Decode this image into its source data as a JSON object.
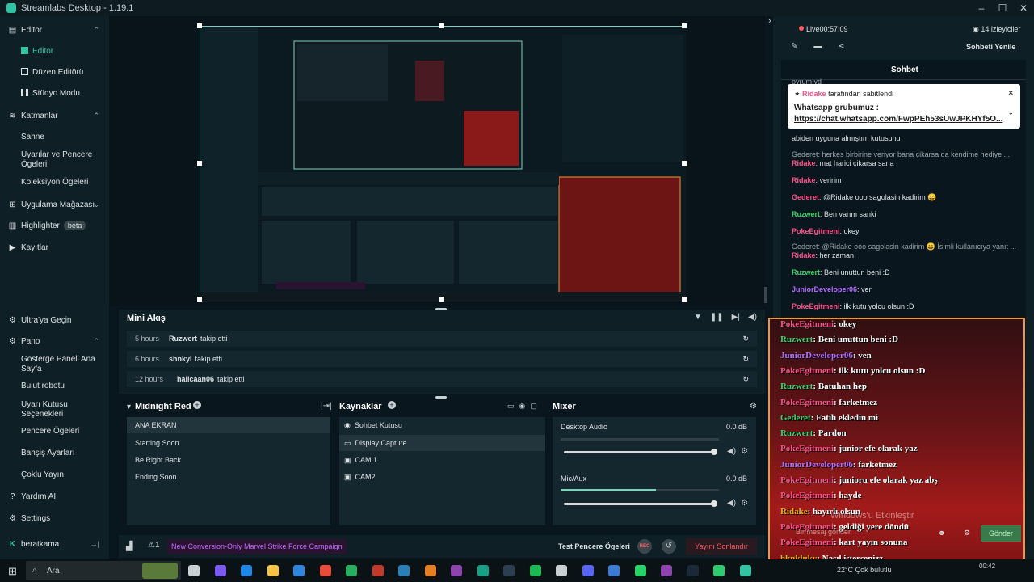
{
  "window": {
    "title": "Streamlabs Desktop - 1.19.1"
  },
  "sidebar": {
    "editor": "Editör",
    "editor_sub": [
      "Editör",
      "Düzen Editörü",
      "Stüdyo Modu"
    ],
    "layers": "Katmanlar",
    "layers_sub": [
      "Sahne",
      "Uyarılar ve Pencere Ögeleri",
      "Koleksiyon Ögeleri"
    ],
    "app_store": "Uygulama Mağazası",
    "highlighter": "Highlighter",
    "highlighter_badge": "beta",
    "recordings": "Kayıtlar",
    "ultra": "Ultra'ya Geçin",
    "dashboard": "Pano",
    "dashboard_sub": [
      "Gösterge Paneli Ana Sayfa",
      "Bulut robotu",
      "Uyarı Kutusu Seçenekleri",
      "Pencere Ögeleri",
      "Bahşiş Ayarları",
      "Çoklu Yayın"
    ],
    "help": "Yardım AI",
    "settings": "Settings",
    "user": "beratkama"
  },
  "mini_feed": {
    "title": "Mini Akış",
    "rows": [
      {
        "time": "5 hours",
        "user": "Ruzwert",
        "action": "takip etti"
      },
      {
        "time": "6 hours",
        "user": "shnkyl",
        "action": "takip etti"
      },
      {
        "time": "12 hours",
        "user": "hallcaan06",
        "action": "takip etti"
      }
    ]
  },
  "scenes": {
    "title": "Midnight Red",
    "items": [
      "ANA EKRAN",
      "Starting Soon",
      "Be Right Back",
      "Ending Soon"
    ],
    "selected": "ANA EKRAN"
  },
  "sources": {
    "title": "Kaynaklar",
    "items": [
      "Sohbet Kutusu",
      "Display Capture",
      "CAM 1",
      "CAM2"
    ],
    "selected": "Display Capture"
  },
  "mixer": {
    "title": "Mixer",
    "channels": [
      {
        "name": "Desktop Audio",
        "db": "0.0 dB",
        "level": 0.0,
        "volume": 0.98
      },
      {
        "name": "Mic/Aux",
        "db": "0.0 dB",
        "level": 0.6,
        "volume": 0.98
      }
    ]
  },
  "footer": {
    "alert_count": "1",
    "campaign": "New Conversion-Only Marvel Strike Force Campaign",
    "test_label": "Test Pencere Ögeleri",
    "rec": "REC",
    "end_stream": "Yayını Sonlandır"
  },
  "live": {
    "status": "Live",
    "time": "00:57:09",
    "viewers": "14 izleyiciler",
    "refresh": "Sohbeti Yenile"
  },
  "chat": {
    "title": "Sohbet",
    "top_partial": "oyrum yd",
    "pinned_by": "Ridake",
    "pinned_suffix": "tarafından sabitlendi",
    "pinned_text": "Whatsapp grubumuz :",
    "pinned_link": "https://chat.whatsapp.com/FwpPEh53sUwJPKHYf5O...",
    "partial_line": "abiden uyguna almıştım kutusunu",
    "reply1": "Gederet: herkes birbirine veriyor bana çikarsa da kendime hediye ...",
    "messages": [
      {
        "user": "Ridake",
        "text": "mat harici çikarsa sana",
        "color": "#ff4f8b"
      },
      {
        "user": "Ridake",
        "text": "veririm",
        "color": "#ff4f8b"
      },
      {
        "user": "Gederet",
        "text": "@Ridake ooo sagolasin kadirim 😄",
        "color": "#ff4f8b"
      },
      {
        "user": "Ruzwert",
        "text": "Ben varım sanki",
        "color": "#38d46b"
      },
      {
        "user": "PokeEgitmeni",
        "text": "okey",
        "color": "#ff4f8b"
      }
    ],
    "reply2": "Gederet: @Ridake ooo sagolasin kadirim 😄 İsimli kullanıcıya yanıt ...",
    "messages2": [
      {
        "user": "Ridake",
        "text": "her zaman",
        "color": "#ff4f8b"
      },
      {
        "user": "Ruzwert",
        "text": "Beni unuttun beni :D",
        "color": "#38d46b"
      },
      {
        "user": "JuniorDeveloper06",
        "text": "ven",
        "color": "#b36bff"
      },
      {
        "user": "PokeEgitmeni",
        "text": "ilk kutu yolcu olsun :D",
        "color": "#ff4f8b"
      }
    ],
    "input_placeholder": "Bir mesaj gönder",
    "send": "Gönder"
  },
  "overlay_chat": [
    {
      "user": "PokeEgitmeni",
      "text": "okey",
      "color": "#ff4f8b"
    },
    {
      "user": "Ruzwert",
      "text": "Beni unuttun beni :D",
      "color": "#38d46b"
    },
    {
      "user": "JuniorDeveloper06",
      "text": "ven",
      "color": "#b36bff"
    },
    {
      "user": "PokeEgitmeni",
      "text": "ilk kutu yolcu olsun :D",
      "color": "#ff4f8b"
    },
    {
      "user": "Ruzwert",
      "text": "Batuhan hep",
      "color": "#38d46b"
    },
    {
      "user": "PokeEgitmeni",
      "text": "farketmez",
      "color": "#ff4f8b"
    },
    {
      "user": "Gederet",
      "text": "Fatih ekledin mi",
      "color": "#38d46b"
    },
    {
      "user": "Ruzwert",
      "text": "Pardon",
      "color": "#38d46b"
    },
    {
      "user": "PokeEgitmeni",
      "text": "junior efe olarak yaz",
      "color": "#ff4f8b"
    },
    {
      "user": "JuniorDeveloper06",
      "text": "farketmez",
      "color": "#b36bff"
    },
    {
      "user": "PokeEgitmeni",
      "text": "junioru efe olarak yaz abş",
      "color": "#ff4f8b"
    },
    {
      "user": "PokeEgitmeni",
      "text": "hayde",
      "color": "#ff4f8b"
    },
    {
      "user": "Ridake",
      "text": "hayırlı olsun",
      "color": "#e8b400"
    },
    {
      "user": "PokeEgitmeni",
      "text": "geldiği yere döndü",
      "color": "#ff4f8b"
    },
    {
      "user": "PokeEgitmeni",
      "text": "kart yayın sonuna",
      "color": "#ff4f8b"
    },
    {
      "user": "hknkluky",
      "text": "Nasıl istersenizz",
      "color": "#e8b400"
    }
  ],
  "watermark": "Windows'u Etkinleştir",
  "taskbar": {
    "search": "Ara",
    "clock": "00:42",
    "weather": "22°C  Çok bulutlu"
  },
  "colors": {
    "accent": "#31c3a2",
    "live": "#ff5a5a",
    "end": "#ff5a6b",
    "overlay_border": "#e89a3c"
  }
}
